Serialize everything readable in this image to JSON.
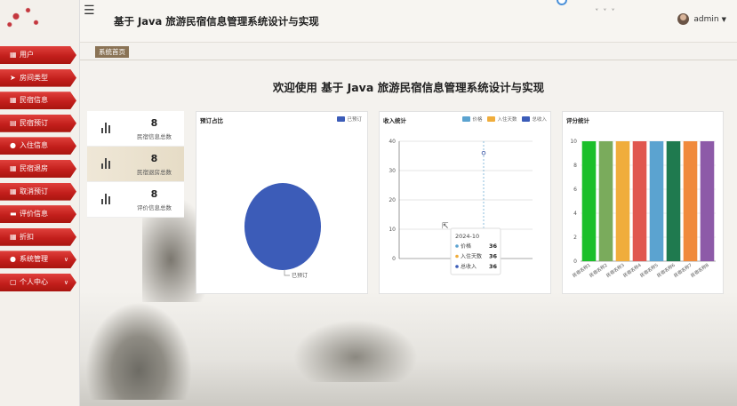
{
  "header": {
    "title": "基于 Java 旅游民宿信息管理系统设计与实现",
    "username": "admin",
    "menu_icon": "hamburger-icon"
  },
  "sidebar": {
    "items": [
      {
        "label": "用户",
        "icon": "grid-icon",
        "chevron": false
      },
      {
        "label": "房间类型",
        "icon": "send-icon",
        "chevron": false
      },
      {
        "label": "民宿信息",
        "icon": "grid-icon",
        "chevron": false
      },
      {
        "label": "民宿预订",
        "icon": "book-icon",
        "chevron": false
      },
      {
        "label": "入住信息",
        "icon": "user-icon",
        "chevron": false
      },
      {
        "label": "民宿退房",
        "icon": "grid-icon",
        "chevron": false
      },
      {
        "label": "取消预订",
        "icon": "grid-icon",
        "chevron": false
      },
      {
        "label": "评价信息",
        "icon": "comment-icon",
        "chevron": false
      },
      {
        "label": "折扣",
        "icon": "grid-icon",
        "chevron": false
      },
      {
        "label": "系统管理",
        "icon": "user-icon",
        "chevron": true
      },
      {
        "label": "个人中心",
        "icon": "window-icon",
        "chevron": true
      }
    ]
  },
  "breadcrumb": "系统首页",
  "welcome": "欢迎使用 基于 Java 旅游民宿信息管理系统设计与实现",
  "stats": [
    {
      "value": "8",
      "label": "民宿信息总数"
    },
    {
      "value": "8",
      "label": "民宿退房总数"
    },
    {
      "value": "8",
      "label": "评价信息总数"
    }
  ],
  "colors": {
    "accent": "#c31f1c",
    "pie": "#3c5cb8",
    "price": "#5ba3d0",
    "days": "#f0ad3c",
    "income": "#3b5cb8"
  },
  "chart_data": [
    {
      "type": "pie",
      "title": "预订占比",
      "legend": [
        "已预订"
      ],
      "slices": [
        {
          "name": "已预订",
          "value": 1
        }
      ]
    },
    {
      "type": "line",
      "title": "收入统计",
      "legend": [
        "价格",
        "入住天数",
        "总收入"
      ],
      "categories": [
        "2024-10"
      ],
      "series": [
        {
          "name": "价格",
          "values": [
            36
          ]
        },
        {
          "name": "入住天数",
          "values": [
            36
          ]
        },
        {
          "name": "总收入",
          "values": [
            36
          ]
        }
      ],
      "yticks": [
        "0",
        "10",
        "20",
        "30",
        "40"
      ],
      "ylim": [
        0,
        40
      ],
      "tooltip": {
        "title": "2024-10",
        "rows": [
          {
            "name": "价格",
            "value": "36"
          },
          {
            "name": "入住天数",
            "value": "36"
          },
          {
            "name": "总收入",
            "value": "36"
          }
        ]
      }
    },
    {
      "type": "bar",
      "title": "评分统计",
      "categories": [
        "民宿名称1",
        "民宿名称2",
        "民宿名称3",
        "民宿名称4",
        "民宿名称5",
        "民宿名称6",
        "民宿名称7",
        "民宿名称8"
      ],
      "values": [
        10,
        10,
        10,
        10,
        10,
        10,
        10,
        10
      ],
      "bar_colors": [
        "#1bbf2a",
        "#7aab5c",
        "#f0ad3c",
        "#e0574f",
        "#5ba3d0",
        "#1f7a4f",
        "#f08a3c",
        "#8d5aa8"
      ],
      "yticks": [
        "0",
        "2",
        "4",
        "6",
        "8",
        "10"
      ],
      "ylim": [
        0,
        10
      ]
    }
  ]
}
